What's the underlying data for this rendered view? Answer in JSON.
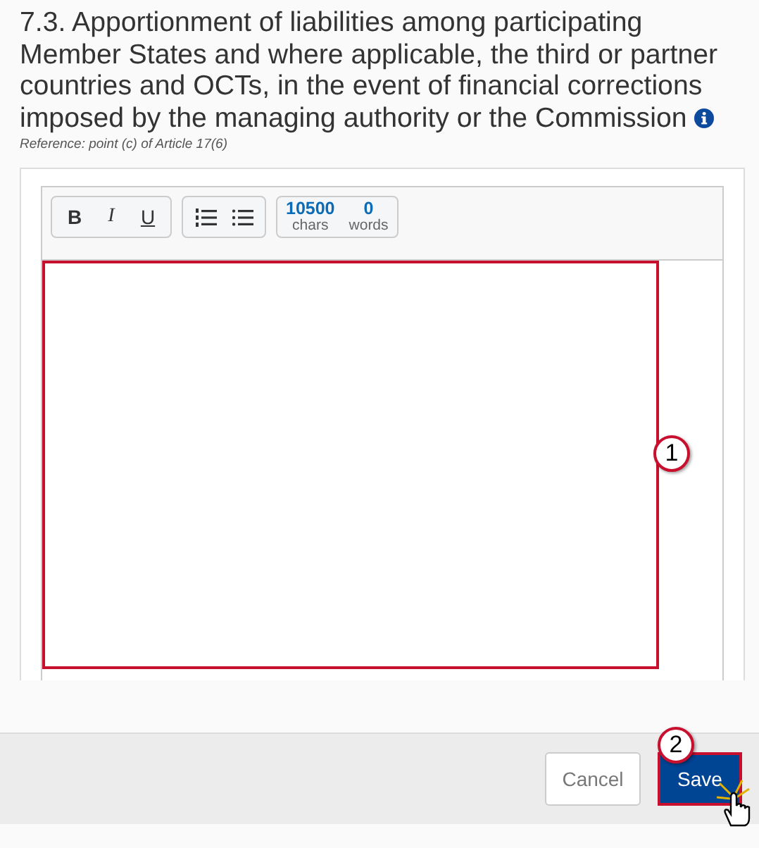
{
  "heading": {
    "title": "7.3. Apportionment of liabilities among participating Member States and where applicable, the third or partner countries and OCTs, in the event of financial corrections imposed by the managing authority or the Commission",
    "reference": "Reference: point (c) of Article 17(6)"
  },
  "toolbar": {
    "format_buttons": [
      {
        "kind": "bold",
        "label": "B"
      },
      {
        "kind": "italic",
        "label": "I"
      },
      {
        "kind": "underline",
        "label": "U"
      }
    ],
    "list_buttons": [
      {
        "kind": "numbered"
      },
      {
        "kind": "bulleted"
      }
    ],
    "counters": [
      {
        "value": "10500",
        "label": "chars"
      },
      {
        "value": "0",
        "label": "words"
      }
    ]
  },
  "editor": {
    "highlighted": true,
    "callout": "1"
  },
  "footer": {
    "cancel": "Cancel",
    "save": "Save",
    "save_highlighted": true,
    "save_callout": "2"
  }
}
